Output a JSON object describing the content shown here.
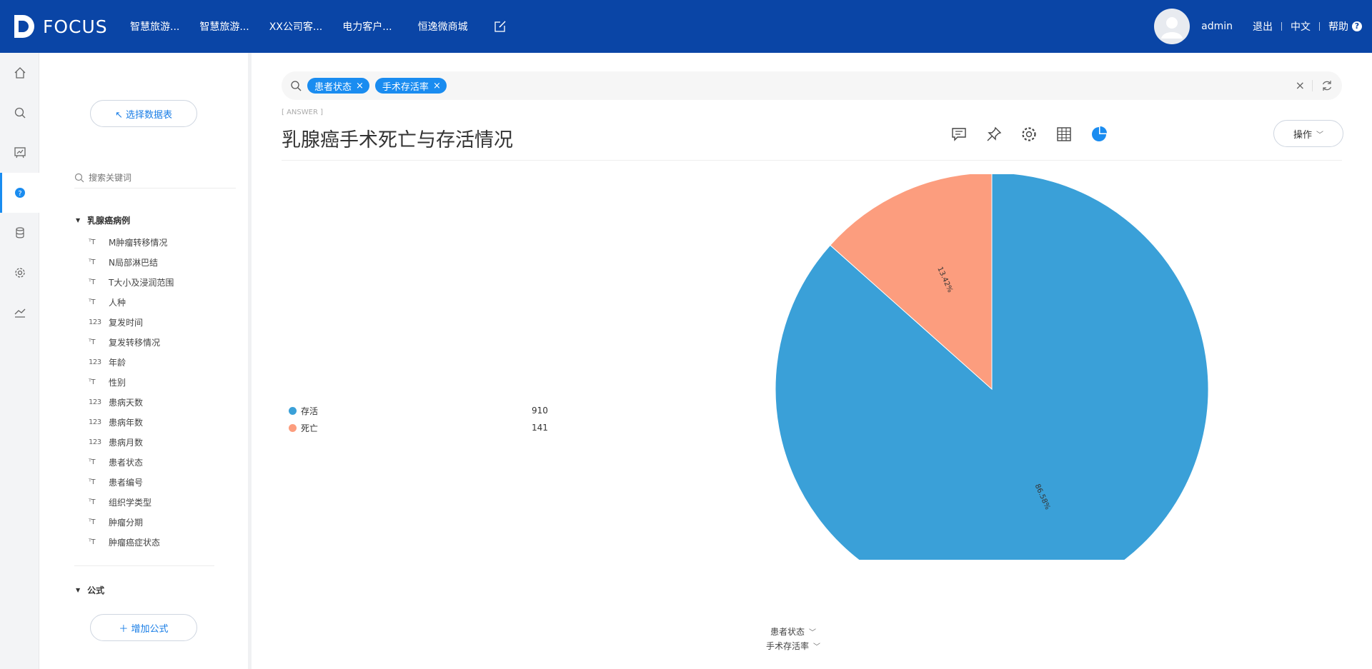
{
  "header": {
    "logo_text": "FOCUS",
    "nav": [
      "智慧旅游...",
      "智慧旅游...",
      "XX公司客...",
      "电力客户...",
      "恒逸微商城"
    ],
    "user": "admin",
    "logout": "退出",
    "language": "中文",
    "help": "帮助",
    "help_glyph": "?"
  },
  "rail": {
    "items": [
      "home-icon",
      "search-icon",
      "dashboard-icon",
      "question-icon",
      "database-icon",
      "settings-icon",
      "trend-icon"
    ],
    "active": "question-icon"
  },
  "panel": {
    "select_table_label": "↖ 选择数据表",
    "search_placeholder": "搜索关键词",
    "group_title": "乳腺癌病例",
    "fields": [
      {
        "type": "text",
        "glyph": "ᵀT",
        "label": "M肿瘤转移情况"
      },
      {
        "type": "text",
        "glyph": "ᵀT",
        "label": "N局部淋巴结"
      },
      {
        "type": "text",
        "glyph": "ᵀT",
        "label": "T大小及浸润范围"
      },
      {
        "type": "text",
        "glyph": "ᵀT",
        "label": "人种"
      },
      {
        "type": "number",
        "glyph": "123",
        "label": "复发时间"
      },
      {
        "type": "text",
        "glyph": "ᵀT",
        "label": "复发转移情况"
      },
      {
        "type": "number",
        "glyph": "123",
        "label": "年龄"
      },
      {
        "type": "text",
        "glyph": "ᵀT",
        "label": "性别"
      },
      {
        "type": "number",
        "glyph": "123",
        "label": "患病天数"
      },
      {
        "type": "number",
        "glyph": "123",
        "label": "患病年数"
      },
      {
        "type": "number",
        "glyph": "123",
        "label": "患病月数"
      },
      {
        "type": "text",
        "glyph": "ᵀT",
        "label": "患者状态"
      },
      {
        "type": "text",
        "glyph": "ᵀT",
        "label": "患者编号"
      },
      {
        "type": "text",
        "glyph": "ᵀT",
        "label": "组织学类型"
      },
      {
        "type": "text",
        "glyph": "ᵀT",
        "label": "肿瘤分期"
      },
      {
        "type": "text",
        "glyph": "ᵀT",
        "label": "肿瘤癌症状态"
      }
    ],
    "formula_title": "公式",
    "add_formula_label": "＋ 增加公式"
  },
  "main": {
    "query_chips": [
      "患者状态",
      "手术存活率"
    ],
    "answer_tag": "[ ANSWER ]",
    "title": "乳腺癌手术死亡与存活情况",
    "toolbar_icons": [
      "comment-icon",
      "pin-icon",
      "gear-icon",
      "table-icon",
      "pie-chart-icon"
    ],
    "operations_label": "操作",
    "axis_selectors": [
      "患者状态",
      "手术存活率"
    ]
  },
  "colors": {
    "header_bg": "#0a45a6",
    "accent": "#1a8cf0",
    "slice_alive": "#3aa0d8",
    "slice_dead": "#fc9d7e"
  },
  "chart_data": {
    "type": "pie",
    "categories": [
      "存活",
      "死亡"
    ],
    "values": [
      910,
      141
    ],
    "slice_labels": [
      "86.58%",
      "13.42%"
    ],
    "colors": [
      "#3aa0d8",
      "#fc9d7e"
    ],
    "legend_position": "left"
  }
}
